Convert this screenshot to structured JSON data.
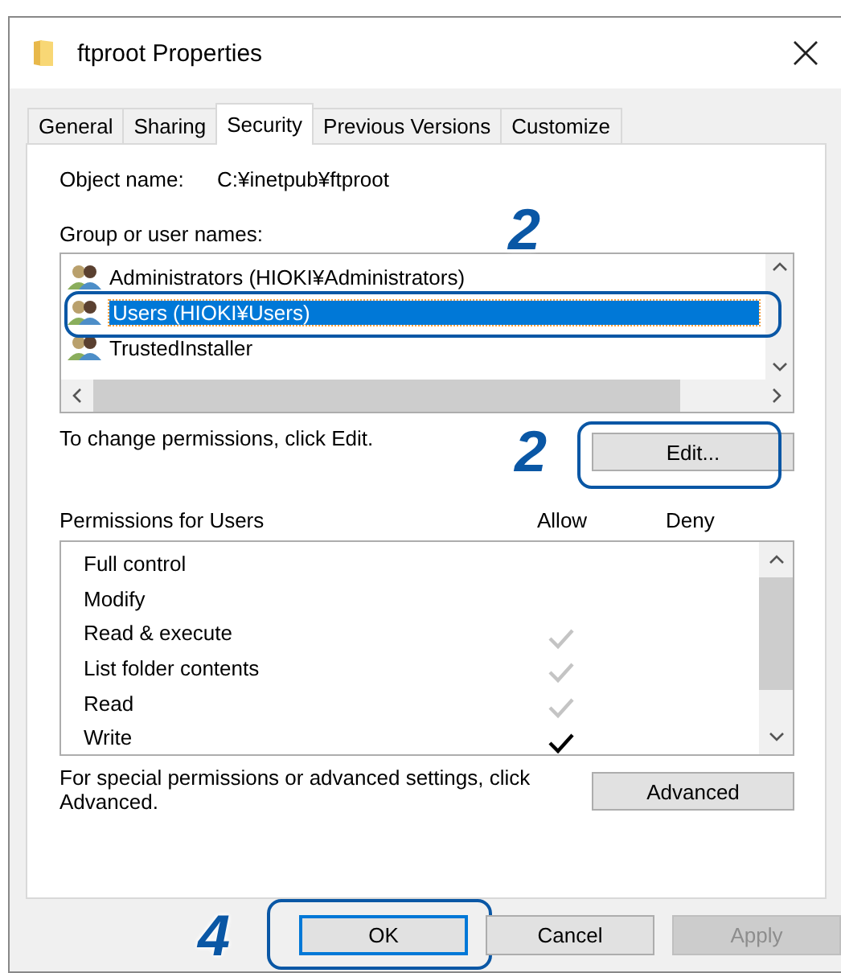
{
  "window": {
    "title": "ftproot Properties"
  },
  "tabs": [
    {
      "label": "General",
      "selected": false
    },
    {
      "label": "Sharing",
      "selected": false
    },
    {
      "label": "Security",
      "selected": true
    },
    {
      "label": "Previous Versions",
      "selected": false
    },
    {
      "label": "Customize",
      "selected": false
    }
  ],
  "object_name": {
    "label": "Object name:",
    "value": "C:¥inetpub¥ftproot"
  },
  "group_list": {
    "label": "Group or user names:",
    "items": [
      {
        "name": "Administrators (HIOKI¥Administrators)",
        "selected": false
      },
      {
        "name": "Users (HIOKI¥Users)",
        "selected": true
      },
      {
        "name": "TrustedInstaller",
        "selected": false
      }
    ]
  },
  "edit_hint": "To change permissions, click Edit.",
  "edit_button": "Edit...",
  "permissions": {
    "label": "Permissions for Users",
    "allow_header": "Allow",
    "deny_header": "Deny",
    "rows": [
      {
        "name": "Full control",
        "allow_checked": false
      },
      {
        "name": "Modify",
        "allow_checked": false
      },
      {
        "name": "Read & execute",
        "allow_checked": true,
        "inherited": true
      },
      {
        "name": "List folder contents",
        "allow_checked": true,
        "inherited": true
      },
      {
        "name": "Read",
        "allow_checked": true,
        "inherited": true
      },
      {
        "name": "Write",
        "allow_checked": true,
        "inherited": false
      }
    ]
  },
  "advanced_hint": "For special permissions or advanced settings, click Advanced.",
  "advanced_button": "Advanced",
  "buttons": [
    {
      "label": "OK",
      "disabled": false,
      "default": true
    },
    {
      "label": "Cancel",
      "disabled": false,
      "default": false
    },
    {
      "label": "Apply",
      "disabled": true,
      "default": false
    }
  ],
  "callouts": {
    "group_list": "2",
    "edit_button": "2",
    "ok_button": "4"
  }
}
